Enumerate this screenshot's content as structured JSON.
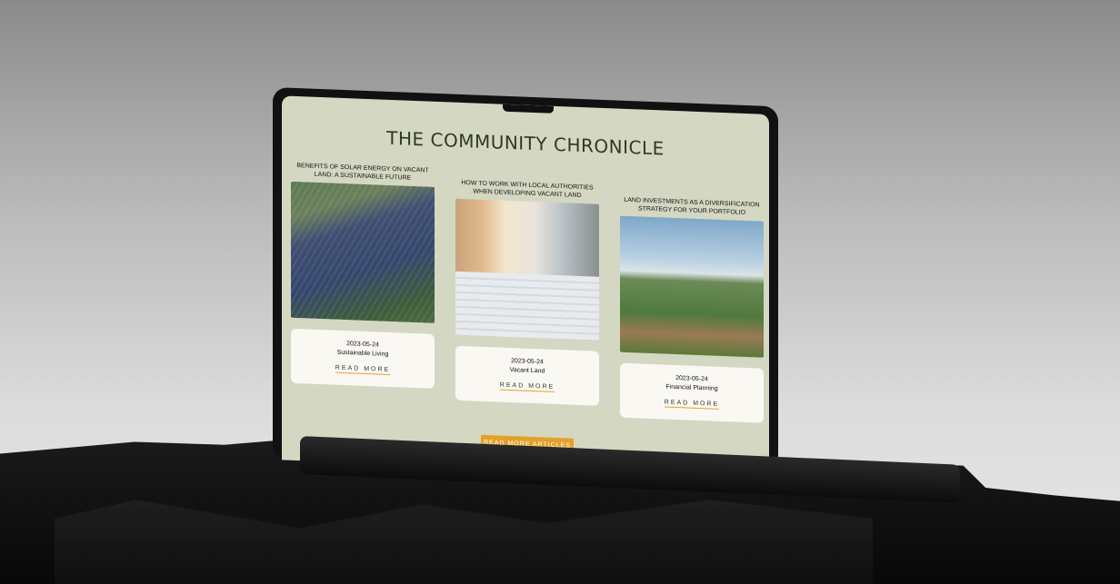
{
  "site": {
    "title": "THE COMMUNITY CHRONICLE"
  },
  "articles": [
    {
      "title": "BENEFITS OF SOLAR ENERGY ON VACANT LAND: A SUSTAINABLE FUTURE",
      "date": "2023-05-24",
      "category": "Sustainable Living",
      "read_more": "READ MORE"
    },
    {
      "title": "HOW TO WORK WITH LOCAL AUTHORITIES WHEN DEVELOPING VACANT LAND",
      "date": "2023-05-24",
      "category": "Vacant Land",
      "read_more": "READ MORE"
    },
    {
      "title": "LAND INVESTMENTS AS A DIVERSIFICATION STRATEGY FOR YOUR PORTFOLIO",
      "date": "2023-05-24",
      "category": "Financial Planning",
      "read_more": "READ MORE"
    }
  ],
  "cta": {
    "label": "READ MORE ARTICLES"
  },
  "colors": {
    "background": "#d4d8c2",
    "accent": "#e3a12b",
    "heading": "#2f3a26"
  }
}
